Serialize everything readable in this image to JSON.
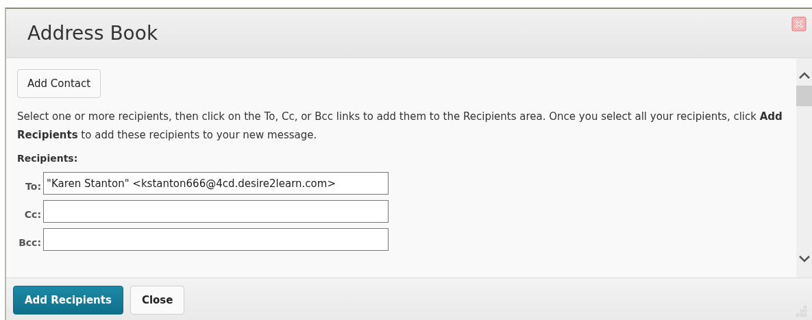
{
  "dialog": {
    "title": "Address Book"
  },
  "add_contact_button": "Add Contact",
  "instructions": "Select one or more recipients, then click on the To, Cc, or Bcc links to add them to the Recipients area. Once you select all your recipients, click **Add Recipients** to add these recipients to your new message.",
  "recipients_heading": "Recipients:",
  "fields": [
    {
      "label": "To:",
      "value": "\"Karen Stanton\" <kstanton666@4cd.desire2learn.com>"
    },
    {
      "label": "Cc:"
    },
    {
      "label": "Bcc:"
    }
  ],
  "buttons": [
    {
      "label": "Add Recipients",
      "kind": "primary"
    },
    {
      "label": "Close",
      "kind": "secondary"
    }
  ]
}
